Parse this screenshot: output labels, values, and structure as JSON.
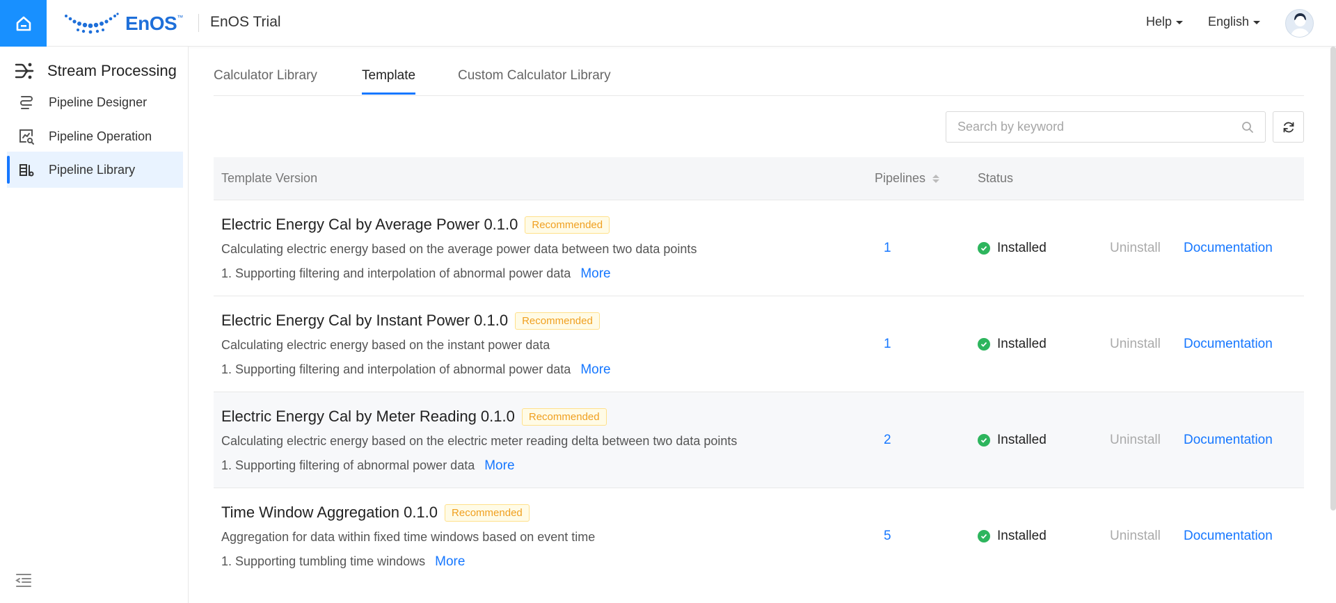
{
  "header": {
    "logo_text": "EnOS",
    "logo_tm": "™",
    "app_title": "EnOS Trial",
    "help_label": "Help",
    "language_label": "English"
  },
  "sidebar": {
    "title": "Stream Processing",
    "items": [
      {
        "label": "Pipeline Designer"
      },
      {
        "label": "Pipeline Operation"
      },
      {
        "label": "Pipeline Library",
        "active": true
      }
    ]
  },
  "tabs": [
    {
      "label": "Calculator Library"
    },
    {
      "label": "Template",
      "active": true
    },
    {
      "label": "Custom Calculator Library"
    }
  ],
  "search": {
    "placeholder": "Search by keyword"
  },
  "table": {
    "columns": {
      "template_version": "Template Version",
      "pipelines": "Pipelines",
      "status": "Status"
    },
    "rows": [
      {
        "title": "Electric Energy Cal by Average Power 0.1.0",
        "tag": "Recommended",
        "desc": "Calculating electric energy based on the average power data between two data points",
        "feature": "1. Supporting filtering and interpolation of abnormal power data",
        "more": "More",
        "pipelines": "1",
        "status": "Installed",
        "uninstall": "Uninstall",
        "documentation": "Documentation"
      },
      {
        "title": "Electric Energy Cal by Instant Power 0.1.0",
        "tag": "Recommended",
        "desc": "Calculating electric energy based on the instant power data",
        "feature": "1. Supporting filtering and interpolation of abnormal power data",
        "more": "More",
        "pipelines": "1",
        "status": "Installed",
        "uninstall": "Uninstall",
        "documentation": "Documentation"
      },
      {
        "title": "Electric Energy Cal by Meter Reading 0.1.0",
        "tag": "Recommended",
        "desc": "Calculating electric energy based on the electric meter reading delta between two data points",
        "feature": "1. Supporting filtering of abnormal power data",
        "more": "More",
        "pipelines": "2",
        "status": "Installed",
        "uninstall": "Uninstall",
        "documentation": "Documentation"
      },
      {
        "title": "Time Window Aggregation 0.1.0",
        "tag": "Recommended",
        "desc": "Aggregation for data within fixed time windows based on event time",
        "feature": "1. Supporting tumbling time windows",
        "more": "More",
        "pipelines": "5",
        "status": "Installed",
        "uninstall": "Uninstall",
        "documentation": "Documentation"
      }
    ]
  },
  "colors": {
    "accent": "#1677ff",
    "home_bg": "#1890ff",
    "tag": "#f0a020",
    "installed": "#2db55d"
  }
}
